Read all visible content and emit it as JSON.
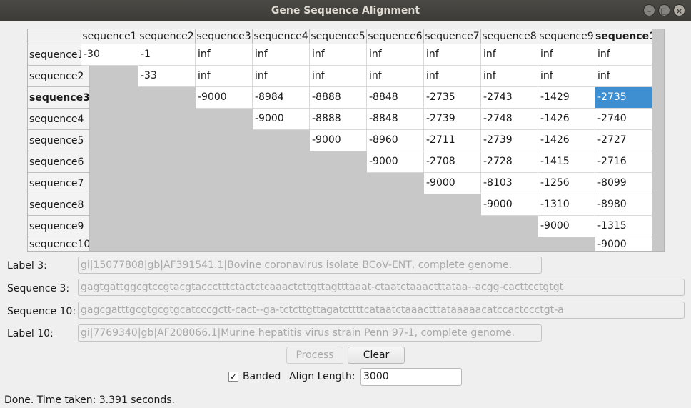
{
  "window": {
    "title": "Gene Sequence Alignment"
  },
  "table": {
    "columns": [
      "sequence1",
      "sequence2",
      "sequence3",
      "sequence4",
      "sequence5",
      "sequence6",
      "sequence7",
      "sequence8",
      "sequence9",
      "sequence10"
    ],
    "rows": [
      "sequence1",
      "sequence2",
      "sequence3",
      "sequence4",
      "sequence5",
      "sequence6",
      "sequence7",
      "sequence8",
      "sequence9",
      "sequence10"
    ],
    "bold_row": "sequence3",
    "bold_column": "sequence10",
    "selected_cell": {
      "row": 2,
      "col": 9
    },
    "cells": [
      [
        "-30",
        "-1",
        "inf",
        "inf",
        "inf",
        "inf",
        "inf",
        "inf",
        "inf",
        "inf"
      ],
      [
        "",
        "-33",
        "inf",
        "inf",
        "inf",
        "inf",
        "inf",
        "inf",
        "inf",
        "inf"
      ],
      [
        "",
        "",
        "-9000",
        "-8984",
        "-8888",
        "-8848",
        "-2735",
        "-2743",
        "-1429",
        "-2735"
      ],
      [
        "",
        "",
        "",
        "-9000",
        "-8888",
        "-8848",
        "-2739",
        "-2748",
        "-1426",
        "-2740"
      ],
      [
        "",
        "",
        "",
        "",
        "-9000",
        "-8960",
        "-2711",
        "-2739",
        "-1426",
        "-2727"
      ],
      [
        "",
        "",
        "",
        "",
        "",
        "-9000",
        "-2708",
        "-2728",
        "-1415",
        "-2716"
      ],
      [
        "",
        "",
        "",
        "",
        "",
        "",
        "-9000",
        "-8103",
        "-1256",
        "-8099"
      ],
      [
        "",
        "",
        "",
        "",
        "",
        "",
        "",
        "-9000",
        "-1310",
        "-8980"
      ],
      [
        "",
        "",
        "",
        "",
        "",
        "",
        "",
        "",
        "-9000",
        "-1315"
      ],
      [
        "",
        "",
        "",
        "",
        "",
        "",
        "",
        "",
        "",
        "-9000"
      ]
    ]
  },
  "fields": {
    "label3": {
      "label": "Label 3:",
      "value": "gi|15077808|gb|AF391541.1|Bovine coronavirus isolate BCoV-ENT, complete genome."
    },
    "seq3": {
      "label": "Sequence 3:",
      "value": "gagtgattggcgtccgtacgtaccctttctactctcaaactcttgttagtttaaat-ctaatctaaactttataa--acgg-cacttcctgtgt"
    },
    "seq10": {
      "label": "Sequence 10:",
      "value": "gagcgatttgcgtgcgtgcatcccgctt-cact--ga-tctcttgttagatcttttcataatctaaactttataaaaacatccactccctgt-a"
    },
    "label10": {
      "label": "Label 10:",
      "value": "gi|7769340|gb|AF208066.1|Murine hepatitis virus strain Penn 97-1, complete genome."
    }
  },
  "buttons": {
    "process": "Process",
    "clear": "Clear"
  },
  "options": {
    "banded_label": "Banded",
    "banded_checked": "✓",
    "align_length_label": "Align Length:",
    "align_length_value": "3000"
  },
  "status": "Done.  Time taken: 3.391 seconds."
}
